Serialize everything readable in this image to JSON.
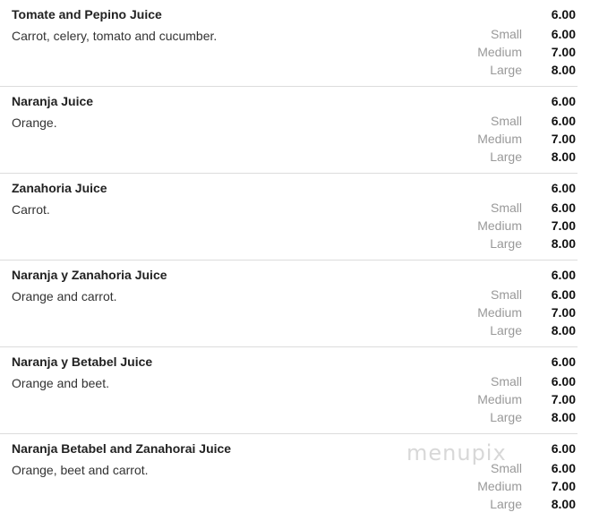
{
  "items": [
    {
      "name": "Tomate and Pepino Juice",
      "description": "Carrot, celery, tomato and cucumber.",
      "price": "6.00",
      "sizes": [
        {
          "label": "Small",
          "price": "6.00"
        },
        {
          "label": "Medium",
          "price": "7.00"
        },
        {
          "label": "Large",
          "price": "8.00"
        }
      ]
    },
    {
      "name": "Naranja Juice",
      "description": "Orange.",
      "price": "6.00",
      "sizes": [
        {
          "label": "Small",
          "price": "6.00"
        },
        {
          "label": "Medium",
          "price": "7.00"
        },
        {
          "label": "Large",
          "price": "8.00"
        }
      ]
    },
    {
      "name": "Zanahoria Juice",
      "description": "Carrot.",
      "price": "6.00",
      "sizes": [
        {
          "label": "Small",
          "price": "6.00"
        },
        {
          "label": "Medium",
          "price": "7.00"
        },
        {
          "label": "Large",
          "price": "8.00"
        }
      ]
    },
    {
      "name": "Naranja y Zanahoria Juice",
      "description": "Orange and carrot.",
      "price": "6.00",
      "sizes": [
        {
          "label": "Small",
          "price": "6.00"
        },
        {
          "label": "Medium",
          "price": "7.00"
        },
        {
          "label": "Large",
          "price": "8.00"
        }
      ]
    },
    {
      "name": "Naranja y Betabel Juice",
      "description": "Orange and beet.",
      "price": "6.00",
      "sizes": [
        {
          "label": "Small",
          "price": "6.00"
        },
        {
          "label": "Medium",
          "price": "7.00"
        },
        {
          "label": "Large",
          "price": "8.00"
        }
      ]
    },
    {
      "name": "Naranja Betabel and Zanahorai Juice",
      "description": "Orange, beet and carrot.",
      "price": "6.00",
      "sizes": [
        {
          "label": "Small",
          "price": "6.00"
        },
        {
          "label": "Medium",
          "price": "7.00"
        },
        {
          "label": "Large",
          "price": "8.00"
        }
      ]
    }
  ],
  "watermark": "menupix"
}
